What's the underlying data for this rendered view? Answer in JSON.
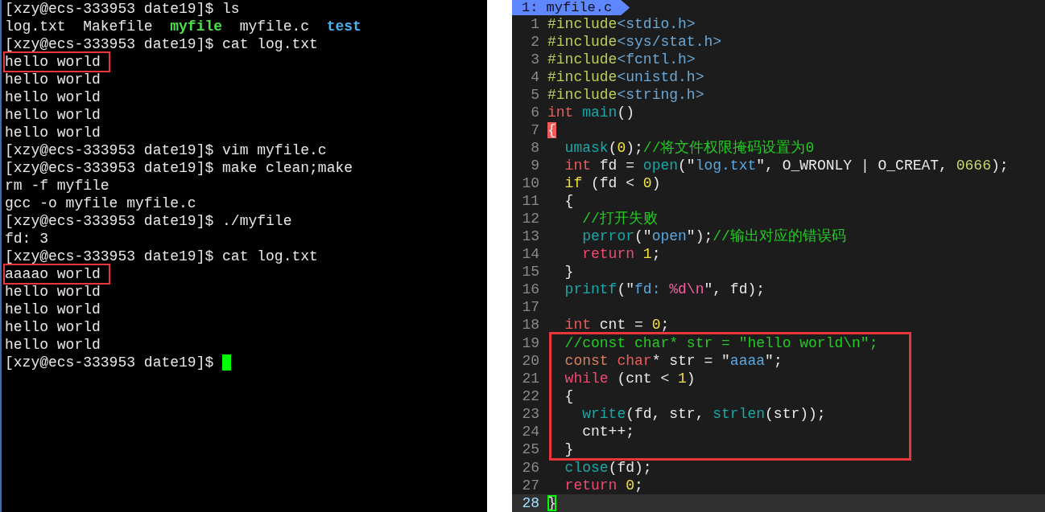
{
  "terminal": {
    "lines": [
      {
        "segments": [
          {
            "text": "[xzy@ecs-333953 date19]$ ls",
            "kind": "plain"
          }
        ],
        "boxed": false,
        "cursor": false
      },
      {
        "segments": [
          {
            "text": "log.txt  Makefile  ",
            "kind": "plain"
          },
          {
            "text": "myfile",
            "kind": "exec"
          },
          {
            "text": "  myfile.c  ",
            "kind": "plain"
          },
          {
            "text": "test",
            "kind": "dir"
          }
        ],
        "boxed": false,
        "cursor": false
      },
      {
        "segments": [
          {
            "text": "[xzy@ecs-333953 date19]$ cat log.txt",
            "kind": "plain"
          }
        ],
        "boxed": false,
        "cursor": false
      },
      {
        "segments": [
          {
            "text": "hello world",
            "kind": "plain"
          }
        ],
        "boxed": true,
        "cursor": false
      },
      {
        "segments": [
          {
            "text": "hello world",
            "kind": "plain"
          }
        ],
        "boxed": false,
        "cursor": false
      },
      {
        "segments": [
          {
            "text": "hello world",
            "kind": "plain"
          }
        ],
        "boxed": false,
        "cursor": false
      },
      {
        "segments": [
          {
            "text": "hello world",
            "kind": "plain"
          }
        ],
        "boxed": false,
        "cursor": false
      },
      {
        "segments": [
          {
            "text": "hello world",
            "kind": "plain"
          }
        ],
        "boxed": false,
        "cursor": false
      },
      {
        "segments": [
          {
            "text": "[xzy@ecs-333953 date19]$ vim myfile.c",
            "kind": "plain"
          }
        ],
        "boxed": false,
        "cursor": false
      },
      {
        "segments": [
          {
            "text": "[xzy@ecs-333953 date19]$ make clean;make",
            "kind": "plain"
          }
        ],
        "boxed": false,
        "cursor": false
      },
      {
        "segments": [
          {
            "text": "rm -f myfile",
            "kind": "plain"
          }
        ],
        "boxed": false,
        "cursor": false
      },
      {
        "segments": [
          {
            "text": "gcc -o myfile myfile.c",
            "kind": "plain"
          }
        ],
        "boxed": false,
        "cursor": false
      },
      {
        "segments": [
          {
            "text": "[xzy@ecs-333953 date19]$ ./myfile",
            "kind": "plain"
          }
        ],
        "boxed": false,
        "cursor": false
      },
      {
        "segments": [
          {
            "text": "fd: 3",
            "kind": "plain"
          }
        ],
        "boxed": false,
        "cursor": false
      },
      {
        "segments": [
          {
            "text": "[xzy@ecs-333953 date19]$ cat log.txt",
            "kind": "plain"
          }
        ],
        "boxed": false,
        "cursor": false
      },
      {
        "segments": [
          {
            "text": "aaaao world",
            "kind": "plain"
          }
        ],
        "boxed": true,
        "cursor": false
      },
      {
        "segments": [
          {
            "text": "hello world",
            "kind": "plain"
          }
        ],
        "boxed": false,
        "cursor": false
      },
      {
        "segments": [
          {
            "text": "hello world",
            "kind": "plain"
          }
        ],
        "boxed": false,
        "cursor": false
      },
      {
        "segments": [
          {
            "text": "hello world",
            "kind": "plain"
          }
        ],
        "boxed": false,
        "cursor": false
      },
      {
        "segments": [
          {
            "text": "hello world",
            "kind": "plain"
          }
        ],
        "boxed": false,
        "cursor": false
      },
      {
        "segments": [
          {
            "text": "[xzy@ecs-333953 date19]$ ",
            "kind": "plain"
          }
        ],
        "boxed": false,
        "cursor": true
      }
    ]
  },
  "editor": {
    "tab": "1: myfile.c",
    "blocks": [
      {
        "boxed": false,
        "lines": [
          {
            "number": "1",
            "tokens": [
              {
                "text": "#include",
                "kind": "preproc"
              },
              {
                "text": "<stdio.h>",
                "kind": "header"
              }
            ],
            "current": false
          },
          {
            "number": "2",
            "tokens": [
              {
                "text": "#include",
                "kind": "preproc"
              },
              {
                "text": "<sys/stat.h>",
                "kind": "header"
              }
            ],
            "current": false
          },
          {
            "number": "3",
            "tokens": [
              {
                "text": "#include",
                "kind": "preproc"
              },
              {
                "text": "<fcntl.h>",
                "kind": "header"
              }
            ],
            "current": false
          },
          {
            "number": "4",
            "tokens": [
              {
                "text": "#include",
                "kind": "preproc"
              },
              {
                "text": "<unistd.h>",
                "kind": "header"
              }
            ],
            "current": false
          },
          {
            "number": "5",
            "tokens": [
              {
                "text": "#include",
                "kind": "preproc"
              },
              {
                "text": "<string.h>",
                "kind": "header"
              }
            ],
            "current": false
          },
          {
            "number": "6",
            "tokens": [
              {
                "text": "int ",
                "kind": "type"
              },
              {
                "text": "main",
                "kind": "func"
              },
              {
                "text": "()",
                "kind": "plain"
              }
            ],
            "current": false
          },
          {
            "number": "7",
            "tokens": [
              {
                "text": "{",
                "kind": "match"
              }
            ],
            "current": false
          },
          {
            "number": "8",
            "tokens": [
              {
                "text": "  umask",
                "kind": "func"
              },
              {
                "text": "(",
                "kind": "plain"
              },
              {
                "text": "0",
                "kind": "number"
              },
              {
                "text": ");",
                "kind": "plain"
              },
              {
                "text": "//将文件权限掩码设置为0",
                "kind": "comment"
              }
            ],
            "current": false
          },
          {
            "number": "9",
            "tokens": [
              {
                "text": "  int",
                "kind": "type"
              },
              {
                "text": " fd = ",
                "kind": "plain"
              },
              {
                "text": "open",
                "kind": "func"
              },
              {
                "text": "(\"",
                "kind": "plain"
              },
              {
                "text": "log.txt",
                "kind": "string"
              },
              {
                "text": "\", O_WRONLY | O_CREAT, ",
                "kind": "plain"
              },
              {
                "text": "0666",
                "kind": "octal"
              },
              {
                "text": ");",
                "kind": "plain"
              }
            ],
            "current": false
          },
          {
            "number": "10",
            "tokens": [
              {
                "text": "  if",
                "kind": "cond"
              },
              {
                "text": " (fd < ",
                "kind": "plain"
              },
              {
                "text": "0",
                "kind": "number"
              },
              {
                "text": ")",
                "kind": "plain"
              }
            ],
            "current": false
          },
          {
            "number": "11",
            "tokens": [
              {
                "text": "  {",
                "kind": "plain"
              }
            ],
            "current": false
          },
          {
            "number": "12",
            "tokens": [
              {
                "text": "    //打开失败",
                "kind": "comment"
              }
            ],
            "current": false
          },
          {
            "number": "13",
            "tokens": [
              {
                "text": "    perror",
                "kind": "func"
              },
              {
                "text": "(\"",
                "kind": "plain"
              },
              {
                "text": "open",
                "kind": "string"
              },
              {
                "text": "\");",
                "kind": "plain"
              },
              {
                "text": "//输出对应的错误码",
                "kind": "comment"
              }
            ],
            "current": false
          },
          {
            "number": "14",
            "tokens": [
              {
                "text": "    return ",
                "kind": "keyword"
              },
              {
                "text": "1",
                "kind": "number"
              },
              {
                "text": ";",
                "kind": "plain"
              }
            ],
            "current": false
          },
          {
            "number": "15",
            "tokens": [
              {
                "text": "  }",
                "kind": "plain"
              }
            ],
            "current": false
          },
          {
            "number": "16",
            "tokens": [
              {
                "text": "  printf",
                "kind": "func"
              },
              {
                "text": "(\"",
                "kind": "plain"
              },
              {
                "text": "fd: ",
                "kind": "string"
              },
              {
                "text": "%d\\n",
                "kind": "format"
              },
              {
                "text": "\", fd);",
                "kind": "plain"
              }
            ],
            "current": false
          },
          {
            "number": "17",
            "current": false
          },
          {
            "number": "18",
            "tokens": [
              {
                "text": "  int",
                "kind": "type"
              },
              {
                "text": " cnt = ",
                "kind": "plain"
              },
              {
                "text": "0",
                "kind": "number"
              },
              {
                "text": ";",
                "kind": "plain"
              }
            ],
            "current": false
          }
        ]
      },
      {
        "boxed": true,
        "lines": [
          {
            "number": "19",
            "tokens": [
              {
                "text": "  //const char* str = \"hello world\\n\";",
                "kind": "comment"
              }
            ],
            "current": false
          },
          {
            "number": "20",
            "tokens": [
              {
                "text": "  const ",
                "kind": "storage"
              },
              {
                "text": "char",
                "kind": "type"
              },
              {
                "text": "* str = \"",
                "kind": "plain"
              },
              {
                "text": "aaaa",
                "kind": "string"
              },
              {
                "text": "\";",
                "kind": "plain"
              }
            ],
            "current": false
          },
          {
            "number": "21",
            "tokens": [
              {
                "text": "  while",
                "kind": "keyword"
              },
              {
                "text": " (cnt < ",
                "kind": "plain"
              },
              {
                "text": "1",
                "kind": "number"
              },
              {
                "text": ")",
                "kind": "plain"
              }
            ],
            "current": false
          },
          {
            "number": "22",
            "tokens": [
              {
                "text": "  {",
                "kind": "plain"
              }
            ],
            "current": false
          },
          {
            "number": "23",
            "tokens": [
              {
                "text": "    write",
                "kind": "func"
              },
              {
                "text": "(fd, str, ",
                "kind": "plain"
              },
              {
                "text": "strlen",
                "kind": "func"
              },
              {
                "text": "(str));",
                "kind": "plain"
              }
            ],
            "current": false
          },
          {
            "number": "24",
            "tokens": [
              {
                "text": "    cnt++;",
                "kind": "plain"
              }
            ],
            "current": false
          },
          {
            "number": "25",
            "tokens": [
              {
                "text": "  }",
                "kind": "plain"
              }
            ],
            "current": false
          }
        ]
      },
      {
        "boxed": false,
        "lines": [
          {
            "number": "26",
            "tokens": [
              {
                "text": "  close",
                "kind": "func"
              },
              {
                "text": "(fd);",
                "kind": "plain"
              }
            ],
            "current": false
          },
          {
            "number": "27",
            "tokens": [
              {
                "text": "  return ",
                "kind": "keyword"
              },
              {
                "text": "0",
                "kind": "number"
              },
              {
                "text": ";",
                "kind": "plain"
              }
            ],
            "current": false
          },
          {
            "number": "28",
            "tokens": [
              {
                "text": "}",
                "kind": "cursor"
              }
            ],
            "current": true
          }
        ]
      }
    ]
  }
}
